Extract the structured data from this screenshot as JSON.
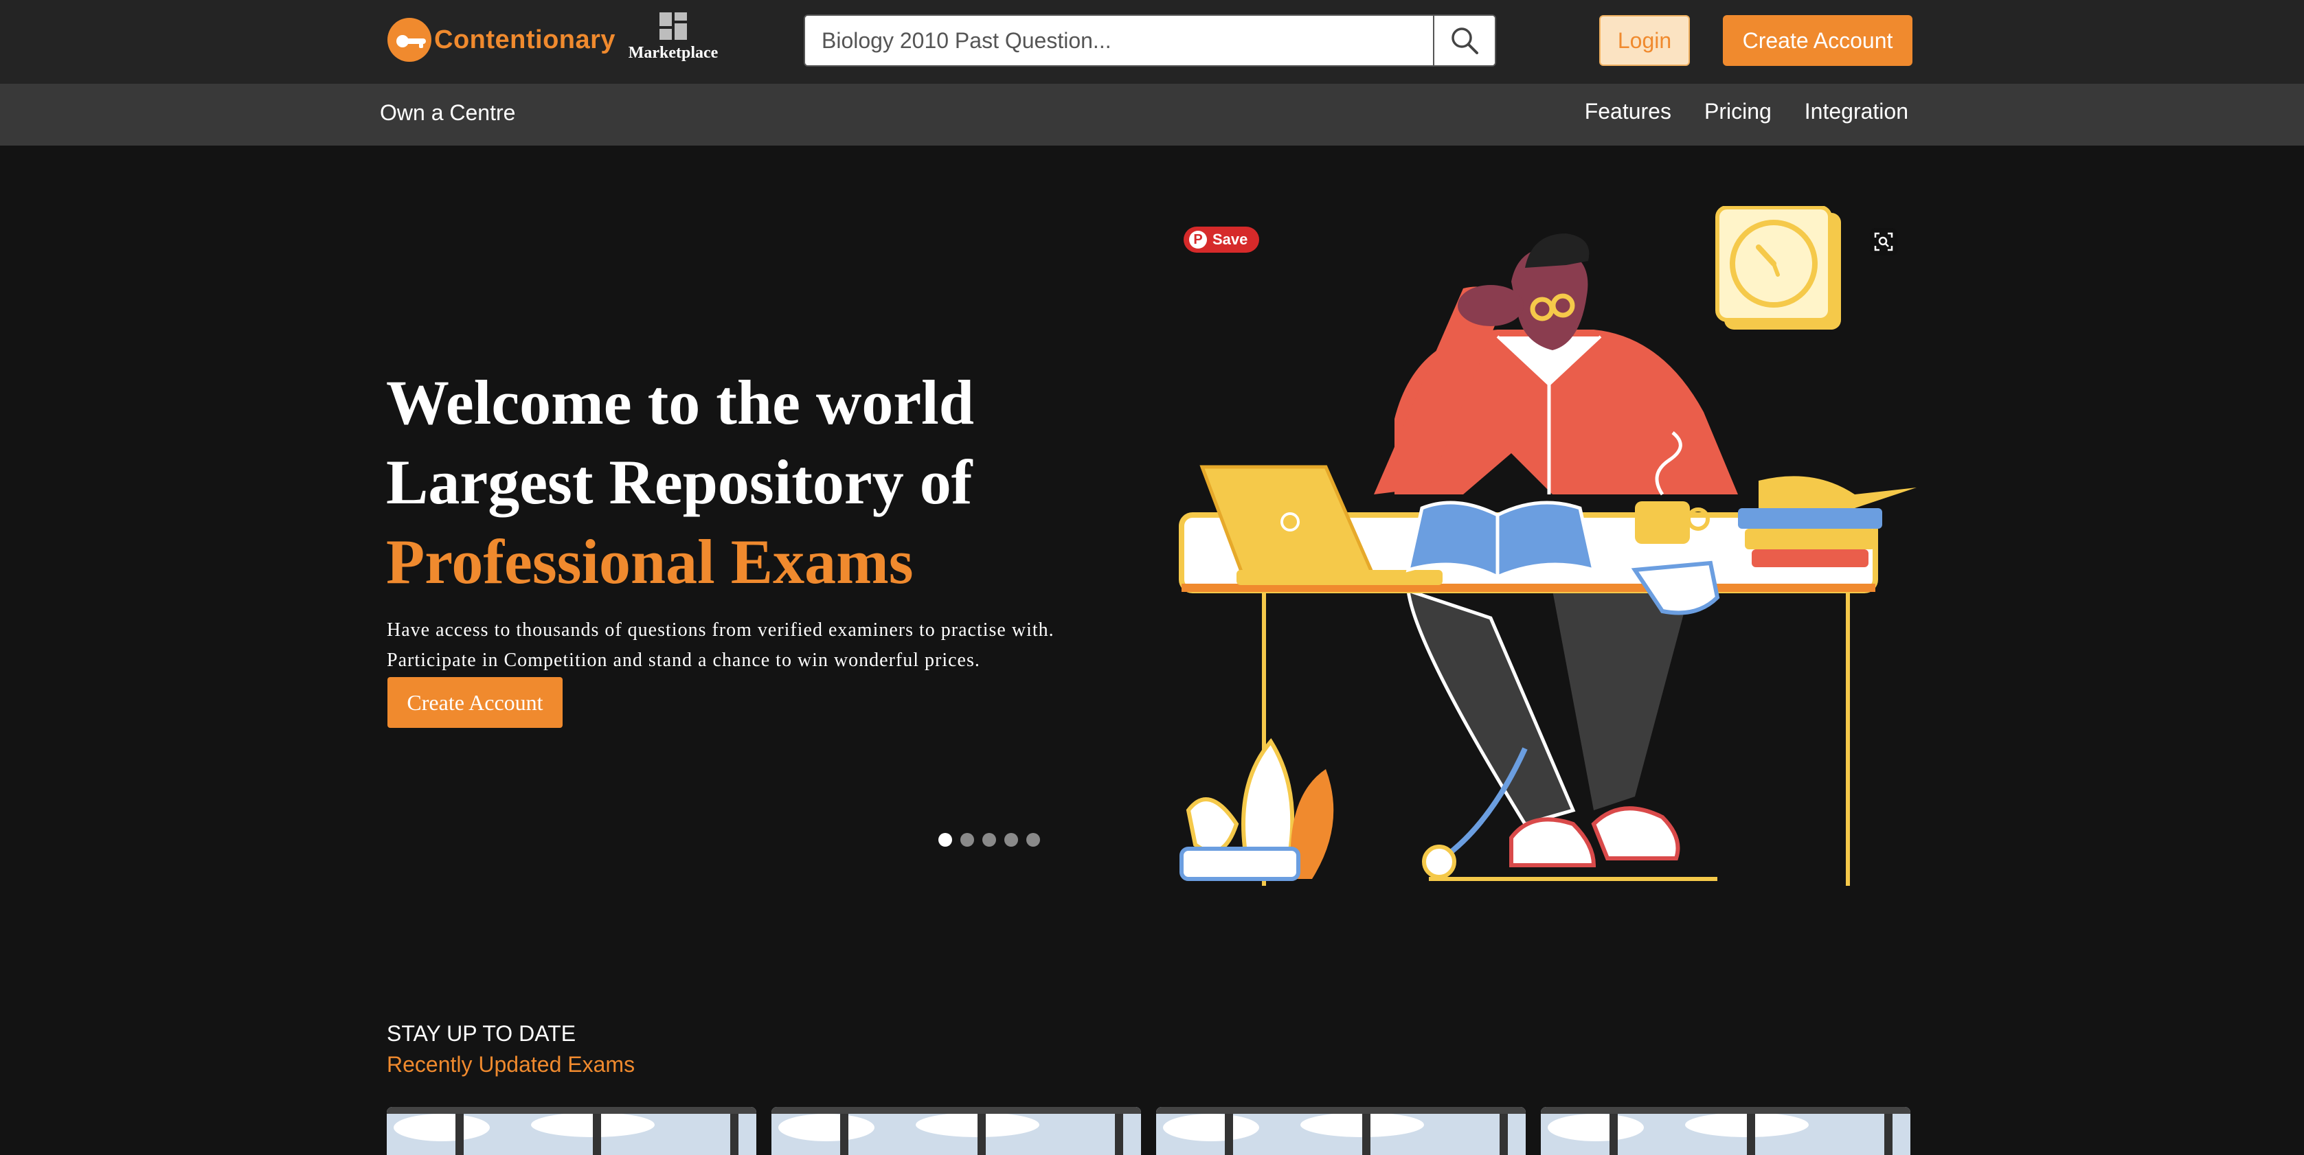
{
  "header": {
    "logo_text": "Contentionary",
    "marketplace_label": "Marketplace",
    "search": {
      "placeholder": "Biology 2010 Past Question..."
    },
    "login_label": "Login",
    "create_account_label": "Create Account"
  },
  "subnav": {
    "left": "Own a Centre",
    "items": [
      "Features",
      "Pricing",
      "Integration"
    ]
  },
  "hero": {
    "title_line1": "Welcome to the world",
    "title_line2": "Largest Repository of",
    "title_accent": "Professional Exams",
    "desc_line1": "Have access to thousands of questions from verified examiners to practise with.",
    "desc_line2": "Participate in Competition and stand a chance to win wonderful prices.",
    "cta_label": "Create Account",
    "slides_total": 5,
    "slides_active": 1
  },
  "save_badge": "Save",
  "section": {
    "kicker": "STAY UP TO DATE",
    "title": "Recently Updated Exams",
    "cards_count": 4
  },
  "colors": {
    "accent": "#f08a2e",
    "topbar": "#242424",
    "subnav": "#393939",
    "background": "#131313"
  },
  "icons": {
    "search": "search-icon",
    "marketplace": "grid-icon",
    "lens": "visual-search-icon"
  }
}
